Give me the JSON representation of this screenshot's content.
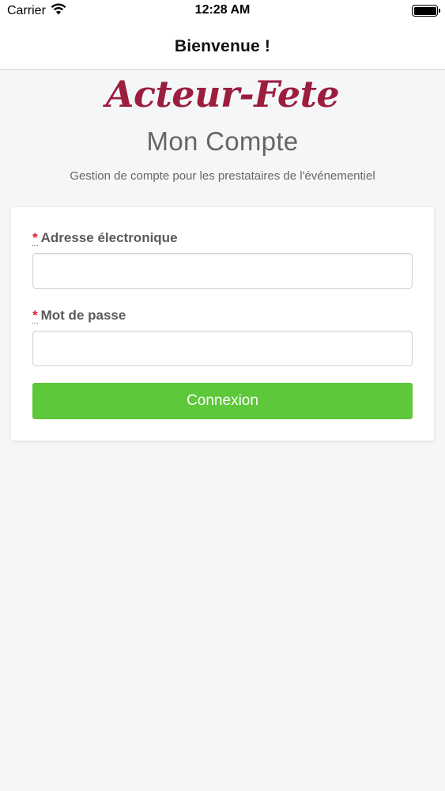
{
  "status_bar": {
    "carrier": "Carrier",
    "time": "12:28 AM",
    "icons": [
      "wifi-icon",
      "battery-icon"
    ]
  },
  "nav": {
    "title": "Bienvenue !"
  },
  "header": {
    "logo_text": "Acteur-Fete",
    "subtitle": "Mon Compte",
    "tagline": "Gestion de compte pour les prestataires de l'événementiel"
  },
  "form": {
    "email": {
      "required_mark": "*",
      "label": "Adresse électronique",
      "value": "",
      "placeholder": ""
    },
    "password": {
      "required_mark": "*",
      "label": "Mot de passe",
      "value": "",
      "placeholder": ""
    },
    "submit_label": "Connexion"
  },
  "colors": {
    "brand": "#9c1e3f",
    "button": "#5cc83a",
    "required": "#d9232d",
    "background": "#f5f6f8"
  }
}
